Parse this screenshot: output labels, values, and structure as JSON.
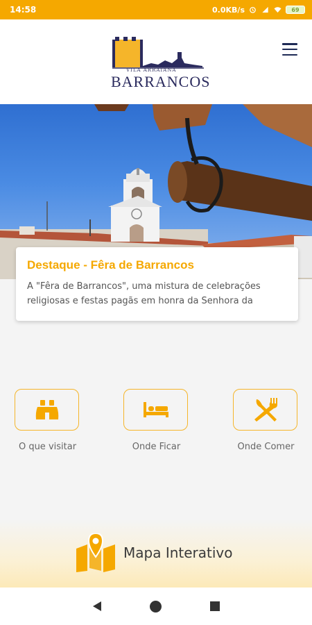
{
  "status_bar": {
    "time": "14:58",
    "network_speed": "0.0KB/s",
    "battery": "69"
  },
  "header": {
    "logo": {
      "subtitle": "VILA ARRAIANA",
      "title": "BARRANCOS"
    },
    "menu_icon": "hamburger-menu-icon"
  },
  "featured": {
    "title": "Destaque - Fêra de Barrancos",
    "text": "A \"Fêra de Barrancos\", uma mistura de celebrações religiosas e festas pagãs em honra da Senhora da"
  },
  "shortcuts": [
    {
      "label": "O que visitar",
      "icon": "binoculars-icon"
    },
    {
      "label": "Onde Ficar",
      "icon": "bed-icon"
    },
    {
      "label": "Onde Comer",
      "icon": "fork-knife-icon"
    }
  ],
  "map_button": {
    "label": "Mapa Interativo",
    "icon": "map-marker-icon"
  },
  "colors": {
    "accent": "#f5a800",
    "navy": "#1e2a55"
  }
}
